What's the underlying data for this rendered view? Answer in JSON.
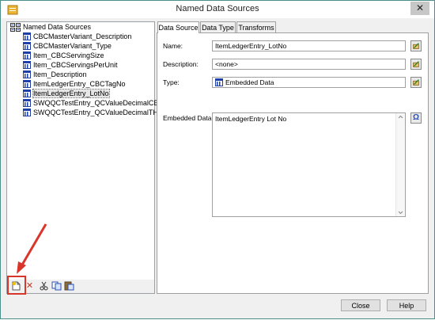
{
  "window": {
    "title": "Named Data Sources",
    "close_glyph": "✕"
  },
  "tree": {
    "root_label": "Named Data Sources",
    "items": [
      {
        "label": "CBCMasterVariant_Description"
      },
      {
        "label": "CBCMasterVariant_Type"
      },
      {
        "label": "Item_CBCServingSize"
      },
      {
        "label": "Item_CBCServingsPerUnit"
      },
      {
        "label": "Item_Description"
      },
      {
        "label": "ItemLedgerEntry_CBCTagNo"
      },
      {
        "label": "ItemLedgerEntry_LotNo",
        "selected": true
      },
      {
        "label": "SWQQCTestEntry_QCValueDecimalCBD"
      },
      {
        "label": "SWQQCTestEntry_QCValueDecimalTHC"
      }
    ]
  },
  "toolbar": {
    "buttons": [
      "new-source-icon",
      "delete-icon",
      "cut-icon",
      "copy-icon",
      "paste-icon"
    ],
    "delete_glyph": "✕"
  },
  "tabs": [
    {
      "label": "Data Source",
      "active": true
    },
    {
      "label": "Data Type"
    },
    {
      "label": "Transforms"
    }
  ],
  "form": {
    "name_label": "Name:",
    "name_value": "ItemLedgerEntry_LotNo",
    "description_label": "Description:",
    "description_value": "<none>",
    "type_label": "Type:",
    "type_value": "Embedded Data",
    "embedded_label": "Embedded Data:",
    "embedded_value": "ItemLedgerEntry Lot No",
    "omega_glyph": "Ω"
  },
  "buttons": {
    "close": "Close",
    "help": "Help"
  },
  "annotation": {
    "color": "#d9362b"
  }
}
